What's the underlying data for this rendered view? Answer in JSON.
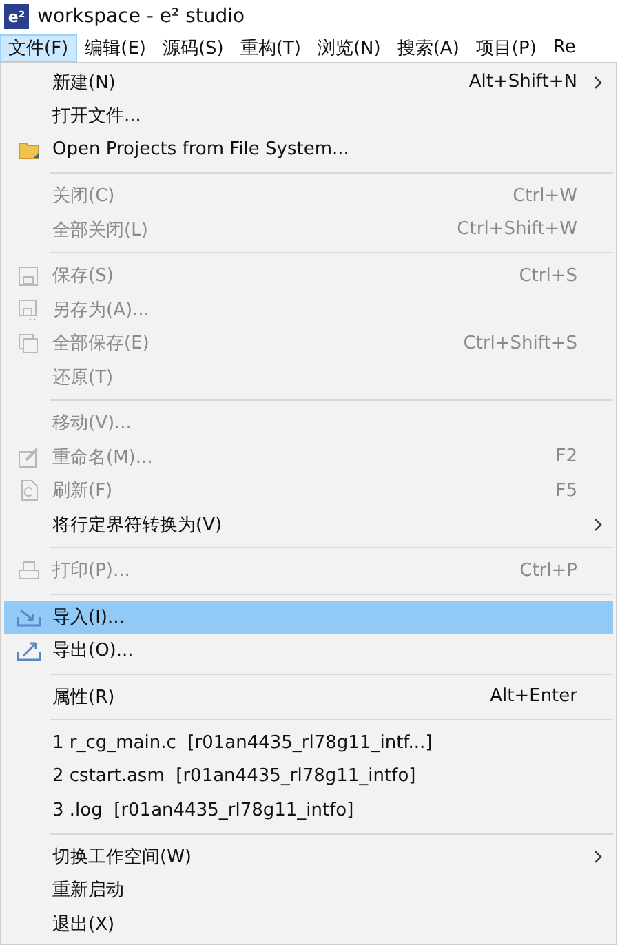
{
  "window": {
    "app_icon": "e²",
    "title": "workspace - e² studio"
  },
  "menubar": [
    {
      "label": "文件(F)",
      "selected": true
    },
    {
      "label": "编辑(E)",
      "selected": false
    },
    {
      "label": "源码(S)",
      "selected": false
    },
    {
      "label": "重构(T)",
      "selected": false
    },
    {
      "label": "浏览(N)",
      "selected": false
    },
    {
      "label": "搜索(A)",
      "selected": false
    },
    {
      "label": "项目(P)",
      "selected": false
    },
    {
      "label": "Re",
      "selected": false
    }
  ],
  "menu": [
    {
      "kind": "item",
      "label": "新建(N)",
      "shortcut": "Alt+Shift+N",
      "submenu": true,
      "disabled": false,
      "selected": false
    },
    {
      "kind": "item",
      "label": "打开文件...",
      "submenu": false,
      "disabled": false,
      "selected": false
    },
    {
      "kind": "item",
      "label": "Open Projects from File System...",
      "submenu": false,
      "disabled": false,
      "selected": false
    },
    {
      "kind": "separator"
    },
    {
      "kind": "item",
      "label": "关闭(C)",
      "shortcut": "Ctrl+W",
      "submenu": false,
      "disabled": true,
      "selected": false
    },
    {
      "kind": "item",
      "label": "全部关闭(L)",
      "shortcut": "Ctrl+Shift+W",
      "submenu": false,
      "disabled": true,
      "selected": false
    },
    {
      "kind": "separator"
    },
    {
      "kind": "item",
      "label": "保存(S)",
      "shortcut": "Ctrl+S",
      "submenu": false,
      "disabled": true,
      "selected": false
    },
    {
      "kind": "item",
      "label": "另存为(A)...",
      "submenu": false,
      "disabled": true,
      "selected": false
    },
    {
      "kind": "item",
      "label": "全部保存(E)",
      "shortcut": "Ctrl+Shift+S",
      "submenu": false,
      "disabled": true,
      "selected": false
    },
    {
      "kind": "item",
      "label": "还原(T)",
      "submenu": false,
      "disabled": true,
      "selected": false
    },
    {
      "kind": "separator"
    },
    {
      "kind": "item",
      "label": "移动(V)...",
      "submenu": false,
      "disabled": true,
      "selected": false
    },
    {
      "kind": "item",
      "label": "重命名(M)...",
      "shortcut": "F2",
      "submenu": false,
      "disabled": true,
      "selected": false
    },
    {
      "kind": "item",
      "label": "刷新(F)",
      "shortcut": "F5",
      "submenu": false,
      "disabled": true,
      "selected": false
    },
    {
      "kind": "item",
      "label": "将行定界符转换为(V)",
      "submenu": true,
      "disabled": false,
      "selected": false
    },
    {
      "kind": "separator"
    },
    {
      "kind": "item",
      "label": "打印(P)...",
      "shortcut": "Ctrl+P",
      "submenu": false,
      "disabled": true,
      "selected": false
    },
    {
      "kind": "separator"
    },
    {
      "kind": "item",
      "label": "导入(I)...",
      "submenu": false,
      "disabled": false,
      "selected": true
    },
    {
      "kind": "item",
      "label": "导出(O)...",
      "submenu": false,
      "disabled": false,
      "selected": false
    },
    {
      "kind": "separator"
    },
    {
      "kind": "item",
      "label": "属性(R)",
      "shortcut": "Alt+Enter",
      "submenu": false,
      "disabled": false,
      "selected": false
    },
    {
      "kind": "separator"
    },
    {
      "kind": "item",
      "label": "1 r_cg_main.c  [r01an4435_rl78g11_intf...]",
      "submenu": false,
      "disabled": false,
      "selected": false
    },
    {
      "kind": "item",
      "label": "2 cstart.asm  [r01an4435_rl78g11_intfo]",
      "submenu": false,
      "disabled": false,
      "selected": false
    },
    {
      "kind": "item",
      "label": "3 .log  [r01an4435_rl78g11_intfo]",
      "submenu": false,
      "disabled": false,
      "selected": false
    },
    {
      "kind": "separator"
    },
    {
      "kind": "item",
      "label": "切换工作空间(W)",
      "submenu": true,
      "disabled": false,
      "selected": false
    },
    {
      "kind": "item",
      "label": "重新启动",
      "submenu": false,
      "disabled": false,
      "selected": false
    },
    {
      "kind": "item",
      "label": "退出(X)",
      "submenu": false,
      "disabled": false,
      "selected": false
    }
  ]
}
